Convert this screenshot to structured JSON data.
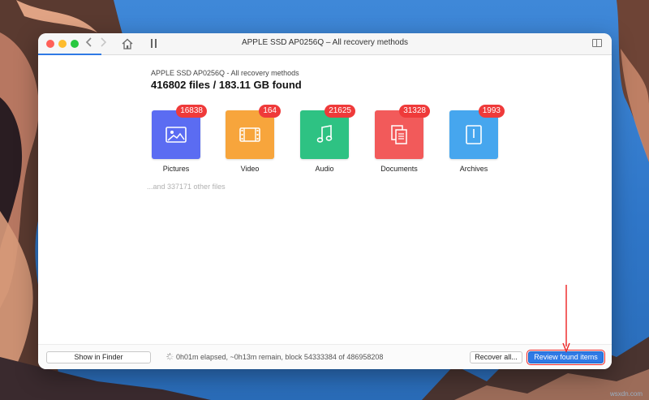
{
  "window": {
    "title": "APPLE SSD AP0256Q – All recovery methods",
    "back_icon": "chevron-left-icon",
    "forward_icon": "chevron-right-icon",
    "home_icon": "home-icon",
    "pause_icon": "pause-icon",
    "sidebar_icon": "sidebar-toggle-icon"
  },
  "scan": {
    "subtitle": "APPLE SSD AP0256Q - All recovery methods",
    "headline": "416802 files / 183.11 GB found",
    "other_files": "...and 337171 other files"
  },
  "categories": [
    {
      "label": "Pictures",
      "count": "16838",
      "icon": "image-icon",
      "color": "#5b6cf2"
    },
    {
      "label": "Video",
      "count": "164",
      "icon": "film-icon",
      "color": "#f7a53c"
    },
    {
      "label": "Audio",
      "count": "21625",
      "icon": "music-note-icon",
      "color": "#2ec283"
    },
    {
      "label": "Documents",
      "count": "31328",
      "icon": "documents-icon",
      "color": "#f25a5a"
    },
    {
      "label": "Archives",
      "count": "1993",
      "icon": "archive-icon",
      "color": "#46a6ee"
    }
  ],
  "footer": {
    "show_in_finder": "Show in Finder",
    "status": "0h01m elapsed, ~0h13m remain, block 54333384 of 486958208",
    "recover_all": "Recover all...",
    "review_found": "Review found items"
  },
  "watermark": "wsxdn.com"
}
